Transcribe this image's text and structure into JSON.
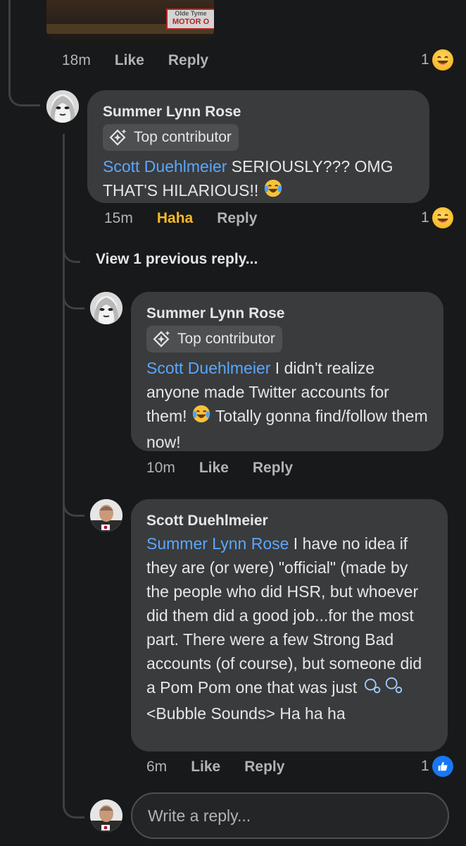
{
  "top_comment": {
    "video_sign_top": "Olde Tyme",
    "video_sign_text": "MOTOR O",
    "time": "18m",
    "like_label": "Like",
    "reply_label": "Reply",
    "reaction_count": "1",
    "reaction_icon": "haha-emoji-icon"
  },
  "comment_1": {
    "author": "Summer Lynn Rose",
    "badge": "Top contributor",
    "mention": "Scott Duehlmeier",
    "text": " SERIOUSLY??? OMG THAT'S HILARIOUS!! ",
    "emoji": "laughing-tears-emoji",
    "time": "15m",
    "reaction_label": "Haha",
    "reply_label": "Reply",
    "reaction_count": "1",
    "reaction_icon": "haha-emoji-icon"
  },
  "view_previous": "View 1 previous reply...",
  "comment_2": {
    "author": "Summer Lynn Rose",
    "badge": "Top contributor",
    "mention": "Scott Duehlmeier",
    "text_a": " I didn't realize anyone made Twitter accounts for them! ",
    "text_b": " Totally gonna find/follow them now!",
    "time": "10m",
    "like_label": "Like",
    "reply_label": "Reply"
  },
  "comment_3": {
    "author": "Scott Duehlmeier",
    "mention": "Summer Lynn Rose",
    "text_a": " I have no idea if they are (or were) \"official\" (made by the people who did HSR, but whoever did them did a good job...for the most part. There were a few Strong Bad accounts (of course), but someone did a Pom Pom one that was just ",
    "text_b": " <Bubble Sounds> Ha ha ha",
    "time": "6m",
    "like_label": "Like",
    "reply_label": "Reply",
    "reaction_count": "1",
    "reaction_icon": "like-thumb-icon"
  },
  "reply_box": {
    "placeholder": "Write a reply..."
  },
  "colors": {
    "background": "#18191a",
    "bubble": "#3a3b3c",
    "mention": "#5aa7ff",
    "haha": "#f7b928",
    "like_blue": "#1877f2"
  }
}
